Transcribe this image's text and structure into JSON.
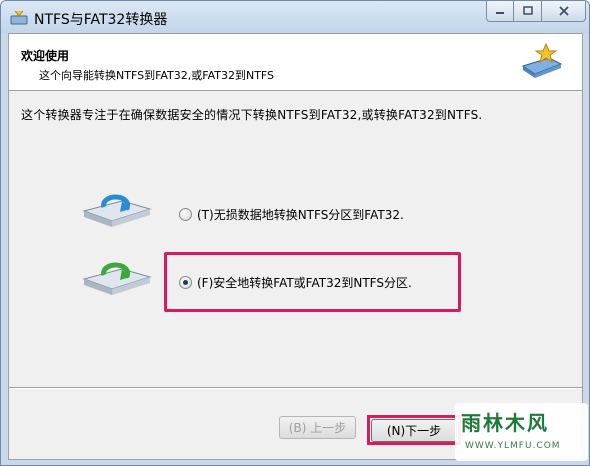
{
  "window": {
    "title": "NTFS与FAT32转换器"
  },
  "header": {
    "title": "欢迎使用",
    "subtitle": "这个向导能转换NTFS到FAT32,或FAT32到NTFS"
  },
  "description": "这个转换器专注于在确保数据安全的情况下转换NTFS到FAT32,或转换FAT32到NTFS.",
  "options": [
    {
      "label": "(T)无损数据地转换NTFS分区到FAT32.",
      "checked": false
    },
    {
      "label": "(F)安全地转换FAT或FAT32到NTFS分区.",
      "checked": true
    }
  ],
  "buttons": {
    "back": "(B) 上一步",
    "next": "(N)下一步"
  },
  "watermark": {
    "text": "雨林木风",
    "url": "WWW.YLMFU.COM"
  },
  "colors": {
    "highlight": "#d81b60",
    "accent": "#1f7a3a"
  }
}
